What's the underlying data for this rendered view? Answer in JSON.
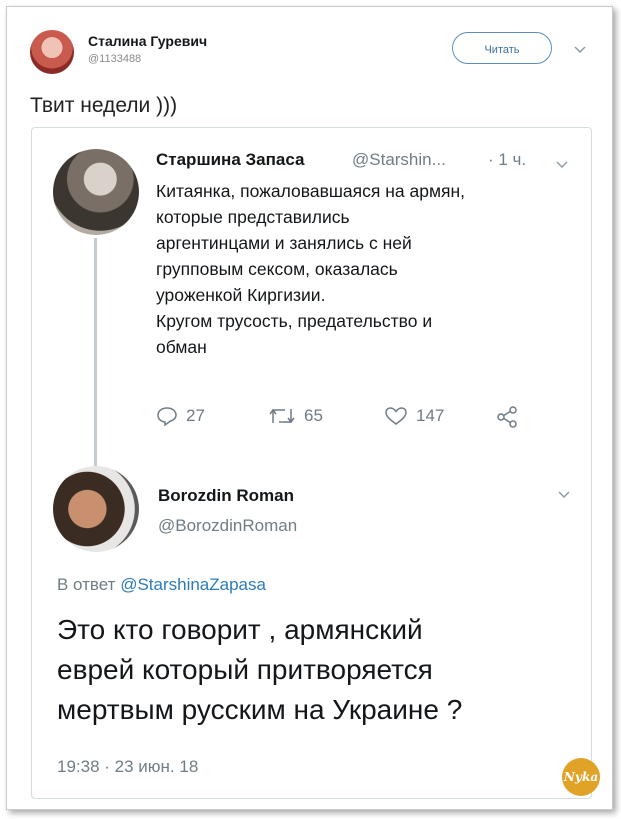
{
  "header": {
    "name": "Сталина Гуревич",
    "handle": "@1133488",
    "follow_label": "Читать",
    "tweet_text": "Твит недели )))"
  },
  "quoted": {
    "name": "Старшина Запаса",
    "handle": "@Starshin...",
    "time": "· 1 ч.",
    "lines": [
      "Китаянка, пожаловавшаяся на армян,",
      "которые представились",
      "аргентинцами и занялись с ней",
      "групповым сексом, оказалась",
      "уроженкой Киргизии.",
      "Кругом трусость, предательство и",
      "обман"
    ],
    "replies": "27",
    "retweets": "65",
    "likes": "147"
  },
  "reply": {
    "name": "Borozdin Roman",
    "handle": "@BorozdinRoman",
    "reply_prefix": "В ответ",
    "reply_mention": "@StarshinaZapasa",
    "lines": [
      "Это кто говорит , армянский",
      "еврей который притворяется",
      "мертвым русским на Украине ?"
    ],
    "timestamp": "19:38 · 23 июн. 18"
  },
  "watermark": {
    "text": "Νуka"
  },
  "icons": {
    "chevron": "chevron-down-icon",
    "reply": "reply-icon",
    "retweet": "retweet-icon",
    "like": "heart-icon",
    "share": "share-icon"
  },
  "colors": {
    "accent": "#2b7bb9",
    "muted": "#707d87",
    "watermark": "#e0a227"
  }
}
